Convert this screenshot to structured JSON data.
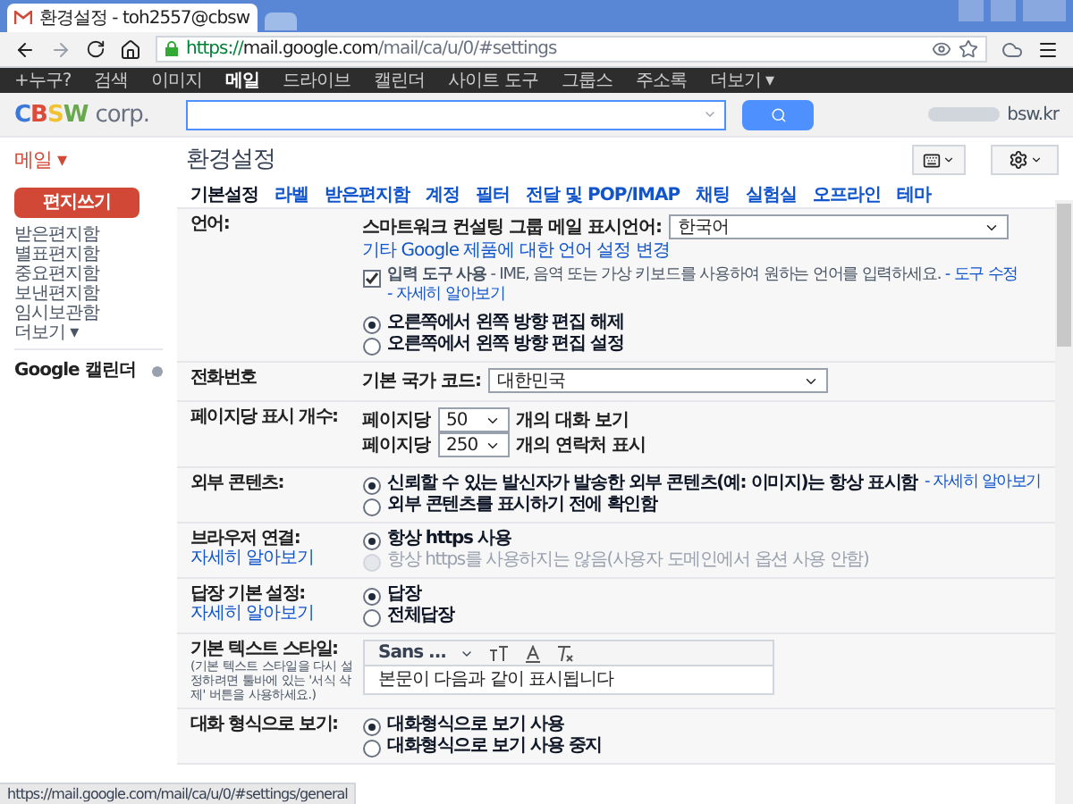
{
  "browser": {
    "tab_title": "환경설정 - toh2557@cbsw",
    "url": {
      "scheme": "https://",
      "host": "mail.google.com",
      "path": "/mail/ca/u/0/#settings"
    }
  },
  "google_bar": [
    {
      "label": "+누구?",
      "selected": false
    },
    {
      "label": "검색",
      "selected": false
    },
    {
      "label": "이미지",
      "selected": false
    },
    {
      "label": "메일",
      "selected": true
    },
    {
      "label": "드라이브",
      "selected": false
    },
    {
      "label": "캘린더",
      "selected": false
    },
    {
      "label": "사이트 도구",
      "selected": false
    },
    {
      "label": "그룹스",
      "selected": false
    },
    {
      "label": "주소록",
      "selected": false
    },
    {
      "label": "더보기 ▾",
      "selected": false
    }
  ],
  "logo": {
    "letters": [
      {
        "text": "C",
        "color": "#3c78d8"
      },
      {
        "text": "B",
        "color": "#dd4b39"
      },
      {
        "text": "S",
        "color": "#f1c232"
      },
      {
        "text": "W",
        "color": "#6aa84f"
      }
    ],
    "suffix": "corp."
  },
  "account": "bsw.kr",
  "mail_menu": "메일 ▾",
  "page_title": "환경설정",
  "compose": "편지쓰기",
  "folders": [
    "받은편지함",
    "별표편지함",
    "중요편지함",
    "보낸편지함",
    "임시보관함",
    "더보기 ▾"
  ],
  "calendar": "Google 캘린더",
  "tabs": [
    {
      "label": "기본설정",
      "selected": true
    },
    {
      "label": "라벨",
      "selected": false
    },
    {
      "label": "받은편지함",
      "selected": false
    },
    {
      "label": "계정",
      "selected": false
    },
    {
      "label": "필터",
      "selected": false
    },
    {
      "label": "전달 및 POP/IMAP",
      "selected": false
    },
    {
      "label": "채팅",
      "selected": false
    },
    {
      "label": "실험실",
      "selected": false
    },
    {
      "label": "오프라인",
      "selected": false
    },
    {
      "label": "테마",
      "selected": false
    }
  ],
  "sections": [
    {
      "label": "언어:",
      "items": [
        {
          "kind": "select",
          "label": "스마트워크 컨설팅 그룹 메일 표시언어:",
          "value": "한국어"
        },
        {
          "kind": "link",
          "text": "기타 Google 제품에 대한 언어 설정 변경"
        },
        {
          "kind": "checkbox",
          "checked": true,
          "text": "**입력 도구 사용** - IME, 음역 또는 가상 키보드를 사용하여 원하는 언어를 입력하세요.",
          "link": "- 도구 수정",
          "link2": "- 자세히 알아보기"
        },
        {
          "kind": "radio",
          "label": "오른쪽에서 왼쪽 방향 편집 해제",
          "selected": true,
          "disabled": false
        },
        {
          "kind": "radio",
          "label": "오른쪽에서 왼쪽 방향 편집 설정",
          "selected": false,
          "disabled": false
        }
      ]
    },
    {
      "label": "전화번호",
      "items": [
        {
          "kind": "select",
          "label": "기본 국가 코드:",
          "value": "대한민국"
        }
      ]
    },
    {
      "label": "페이지당 표시 개수:",
      "items": [
        {
          "kind": "pagesize",
          "prefix": "페이지당",
          "value": "50",
          "suffix": "개의 대화 보기"
        },
        {
          "kind": "pagesize",
          "prefix": "페이지당",
          "value": "250",
          "suffix": "개의 연락처 표시"
        }
      ]
    },
    {
      "label": "외부 콘텐츠:",
      "items": [
        {
          "kind": "radio",
          "label": "신뢰할 수 있는 발신자가 발송한 외부 콘텐츠(예: 이미지)는 항상 표시함",
          "link": "- 자세히 알아보기",
          "selected": true,
          "disabled": false
        },
        {
          "kind": "radio",
          "label": "외부 콘텐츠를 표시하기 전에 확인함",
          "selected": false,
          "disabled": false
        }
      ]
    },
    {
      "label": "브라우저 연결:",
      "label_link": "자세히 알아보기",
      "items": [
        {
          "kind": "radio",
          "label": "항상 https 사용",
          "selected": true,
          "disabled": false
        },
        {
          "kind": "radio",
          "label": "항상 https를 사용하지는 않음(사용자 도메인에서 옵션 사용 안함)",
          "selected": false,
          "disabled": true
        }
      ]
    },
    {
      "label": "답장 기본 설정:",
      "label_link": "자세히 알아보기",
      "items": [
        {
          "kind": "radio",
          "label": "답장",
          "selected": true,
          "disabled": false
        },
        {
          "kind": "radio",
          "label": "전체답장",
          "selected": false,
          "disabled": false
        }
      ]
    },
    {
      "label": "기본 텍스트 스타일:",
      "label_note": "(기본 텍스트 스타일을 다시 설정하려면 툴바에 있는 '서식 삭제' 버튼을 사용하세요.)",
      "items": [
        {
          "kind": "editor",
          "font": "Sans ...",
          "preview": "본문이 다음과 같이 표시됩니다"
        }
      ]
    },
    {
      "label": "대화 형식으로 보기:",
      "items": [
        {
          "kind": "radio",
          "label": "대화형식으로 보기 사용",
          "selected": true,
          "disabled": false
        },
        {
          "kind": "radio",
          "label": "대화형식으로 보기 사용 중지",
          "selected": false,
          "disabled": false
        }
      ]
    }
  ],
  "status_url": "https://mail.google.com/mail/ca/u/0/#settings/general"
}
